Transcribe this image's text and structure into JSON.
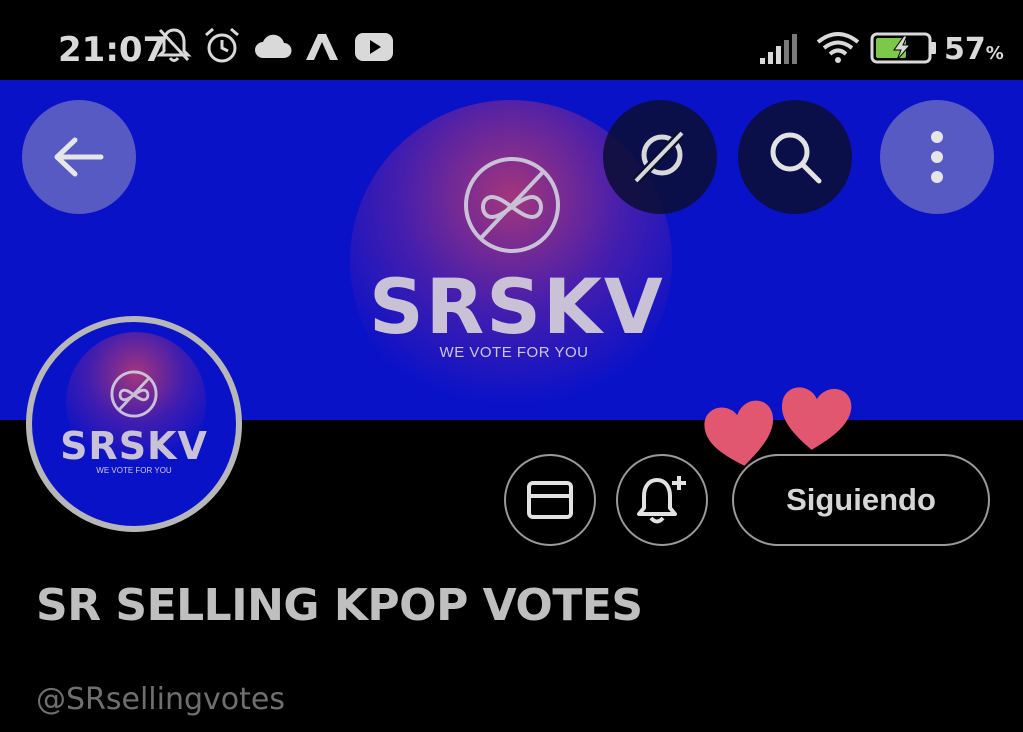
{
  "status_bar": {
    "time": "21:07",
    "icons": [
      "bell-off-icon",
      "alarm-icon",
      "cloud-icon",
      "app-a-icon",
      "youtube-icon",
      "signal-icon",
      "wifi-icon",
      "battery-charging-icon"
    ],
    "battery_percent": "57",
    "battery_unit": "%"
  },
  "header": {
    "back_icon": "arrow-left-icon",
    "grok_icon": "grok-icon",
    "search_icon": "search-icon",
    "more_icon": "more-vertical-icon",
    "banner": {
      "logo_text": "SRSKV",
      "tagline": "WE VOTE FOR YOU",
      "background_color": "#0a12c8"
    }
  },
  "profile": {
    "avatar": {
      "logo_text": "SRSKV",
      "tagline": "WE VOTE FOR YOU"
    },
    "actions": {
      "message_icon": "envelope-icon",
      "notify_icon": "bell-plus-icon",
      "following_label": "Siguiendo"
    },
    "display_name": "SR SELLING KPOP VOTES",
    "handle": "@SRsellingvotes"
  },
  "decorations": {
    "hearts_color": "#e0576f"
  }
}
